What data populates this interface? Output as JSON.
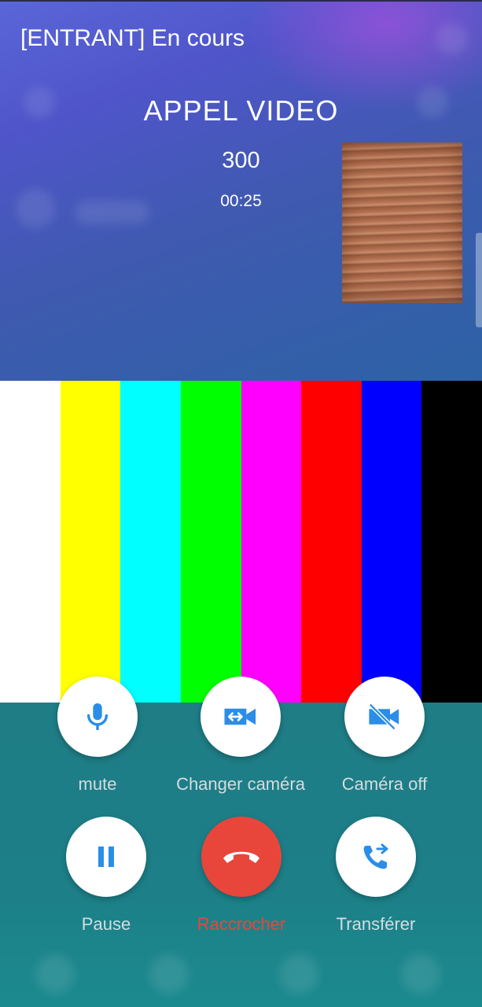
{
  "header": {
    "status": "[ENTRANT] En cours",
    "title": "APPEL VIDEO",
    "number": "300",
    "timer": "00:25"
  },
  "test_pattern": {
    "colors": [
      "#ffffff",
      "#ffff00",
      "#00ffff",
      "#00ff00",
      "#ff00ff",
      "#ff0000",
      "#0000ff",
      "#000000"
    ]
  },
  "controls": {
    "mute": {
      "label": "mute",
      "icon": "microphone-icon"
    },
    "switch_camera": {
      "label": "Changer caméra",
      "icon": "switch-camera-icon"
    },
    "camera_off": {
      "label": "Caméra off",
      "icon": "camera-off-icon"
    },
    "pause": {
      "label": "Pause",
      "icon": "pause-icon"
    },
    "hangup": {
      "label": "Raccrocher",
      "icon": "hangup-phone-icon"
    },
    "transfer": {
      "label": "Transférer",
      "icon": "transfer-call-icon"
    }
  },
  "colors": {
    "accent": "#2a8ee8",
    "hangup": "#e8463a",
    "label": "#d3dde0"
  }
}
